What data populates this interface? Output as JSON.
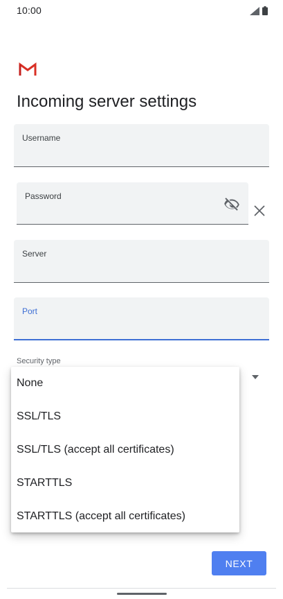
{
  "status_bar": {
    "time": "10:00",
    "icons": [
      "signal-icon",
      "battery-icon"
    ]
  },
  "app": {
    "logo_icon": "gmail-logo-icon",
    "title": "Incoming server settings"
  },
  "form": {
    "username": {
      "label": "Username",
      "value": ""
    },
    "password": {
      "label": "Password",
      "value": "",
      "toggle_icon": "visibility-off-icon",
      "clear_icon": "close-icon"
    },
    "server": {
      "label": "Server",
      "value": ""
    },
    "port": {
      "label": "Port",
      "value": "",
      "focused": true
    },
    "security_type": {
      "label": "Security type",
      "arrow_icon": "dropdown-arrow-icon"
    }
  },
  "security_menu": {
    "options": [
      "None",
      "SSL/TLS",
      "SSL/TLS (accept all certificates)",
      "STARTTLS",
      "STARTTLS (accept all certificates)"
    ]
  },
  "actions": {
    "next_label": "NEXT"
  },
  "colors": {
    "accent": "#3d6ed4",
    "button": "#4f7ff0",
    "field_bg": "#f1f3f4",
    "gmail_red": "#d93025"
  }
}
